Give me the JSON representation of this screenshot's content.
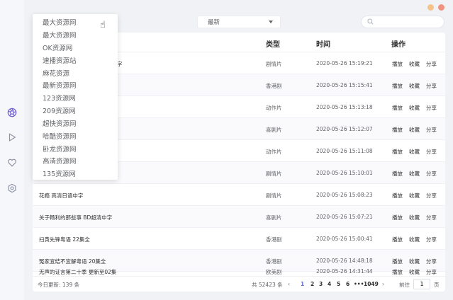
{
  "window": {
    "dot_yellow": "#f5c28a",
    "dot_red": "#f0937f"
  },
  "sidebar": {
    "items": [
      {
        "icon": "aperture-icon",
        "active": true,
        "color": "#6f5fd0"
      },
      {
        "icon": "play-icon",
        "active": false
      },
      {
        "icon": "heart-icon",
        "active": false
      },
      {
        "icon": "gear-icon",
        "active": false
      }
    ]
  },
  "toolbar": {
    "sort_selected": "最新",
    "search_placeholder": ""
  },
  "source_dropdown": {
    "items": [
      "最大资源网",
      "最大资源网",
      "OK资源网",
      "速播资源站",
      "麻花资源",
      "最新资源网",
      "123资源网",
      "209资源网",
      "超快资源网",
      "哈酷资源网",
      "卧龙资源网",
      "高清资源网",
      "135资源网"
    ]
  },
  "table": {
    "headers": {
      "type": "类型",
      "time": "时间",
      "actions": "操作"
    },
    "action_labels": {
      "play": "播放",
      "collect": "收藏",
      "share": "分享"
    },
    "rows": [
      {
        "title": "字",
        "type": "剧情片",
        "time": "2020-05-26 15:19:21"
      },
      {
        "title": "",
        "type": "香港剧",
        "time": "2020-05-26 15:15:41"
      },
      {
        "title": "",
        "type": "动作片",
        "time": "2020-05-26 15:13:18"
      },
      {
        "title": "",
        "type": "喜剧片",
        "time": "2020-05-26 15:12:07"
      },
      {
        "title": "",
        "type": "动作片",
        "time": "2020-05-26 15:11:08"
      },
      {
        "title": "",
        "type": "剧情片",
        "time": "2020-05-26 15:10:01"
      },
      {
        "title": "花瘾 高清日语中字",
        "type": "剧情片",
        "time": "2020-05-26 15:08:23"
      },
      {
        "title": "关于畅利的那些事 BD超清中字",
        "type": "喜剧片",
        "time": "2020-05-26 15:07:21"
      },
      {
        "title": "扫黄先锋粤语 22集全",
        "type": "香港剧",
        "time": "2020-05-26 15:00:41"
      },
      {
        "title": "冤家宜结不宜解粤语 20集全",
        "type": "香港剧",
        "time": "2020-05-26 14:48:18"
      },
      {
        "title": "无声的证言第二十季 更新至02集",
        "type": "欧美剧",
        "time": "2020-05-26 14:31:44"
      }
    ]
  },
  "footer": {
    "today_updates": "今日更新: 139 条",
    "total": "共 52423 条",
    "prev": "‹",
    "next": "›",
    "pages": [
      "1",
      "2",
      "3",
      "4",
      "5",
      "6"
    ],
    "ellipsis": "•••",
    "last_page": "1049",
    "goto_label": "前往",
    "goto_value": "1",
    "page_unit": "页",
    "active_color": "#5f6fd8"
  }
}
